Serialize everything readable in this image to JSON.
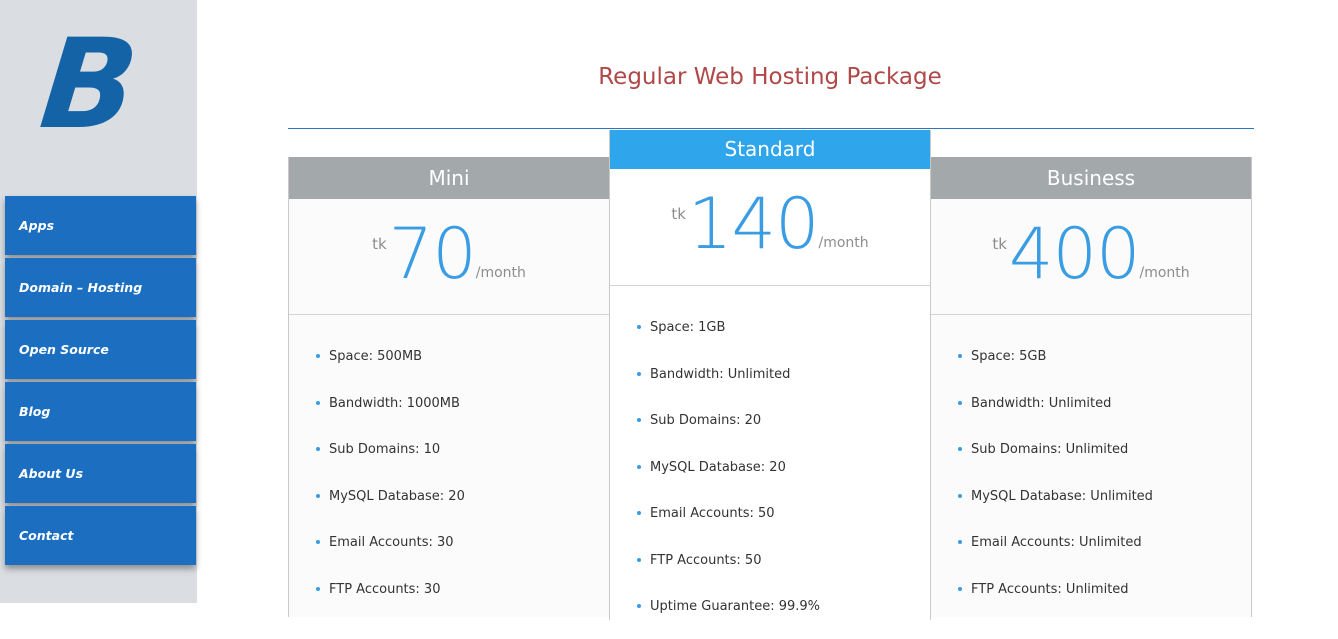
{
  "sidebar": {
    "logo_text": "B",
    "nav": [
      {
        "label": "Apps"
      },
      {
        "label": "Domain – Hosting"
      },
      {
        "label": "Open Source"
      },
      {
        "label": "Blog"
      },
      {
        "label": "About Us"
      },
      {
        "label": "Contact"
      }
    ]
  },
  "main": {
    "title": "Regular Web Hosting Package",
    "plans": [
      {
        "name": "Mini",
        "currency": "tk",
        "price": "70",
        "period": "/month",
        "features": [
          "Space: 500MB",
          "Bandwidth: 1000MB",
          "Sub Domains: 10",
          "MySQL Database: 20",
          "Email Accounts: 30",
          "FTP Accounts: 30"
        ]
      },
      {
        "name": "Standard",
        "currency": "tk",
        "price": "140",
        "period": "/month",
        "features": [
          "Space: 1GB",
          "Bandwidth: Unlimited",
          "Sub Domains: 20",
          "MySQL Database: 20",
          "Email Accounts: 50",
          "FTP Accounts: 50",
          "Uptime Guarantee: 99.9%"
        ]
      },
      {
        "name": "Business",
        "currency": "tk",
        "price": "400",
        "period": "/month",
        "features": [
          "Space: 5GB",
          "Bandwidth: Unlimited",
          "Sub Domains: Unlimited",
          "MySQL Database: Unlimited",
          "Email Accounts: Unlimited",
          "FTP Accounts: Unlimited"
        ]
      }
    ]
  },
  "colors": {
    "sidebar_bg": "#dadee2",
    "nav_bg": "#1c6fc0",
    "title": "#b04848",
    "accent": "#3a9ce3",
    "featured_header": "#2fa5ec",
    "plan_header": "#a3a8ab"
  }
}
